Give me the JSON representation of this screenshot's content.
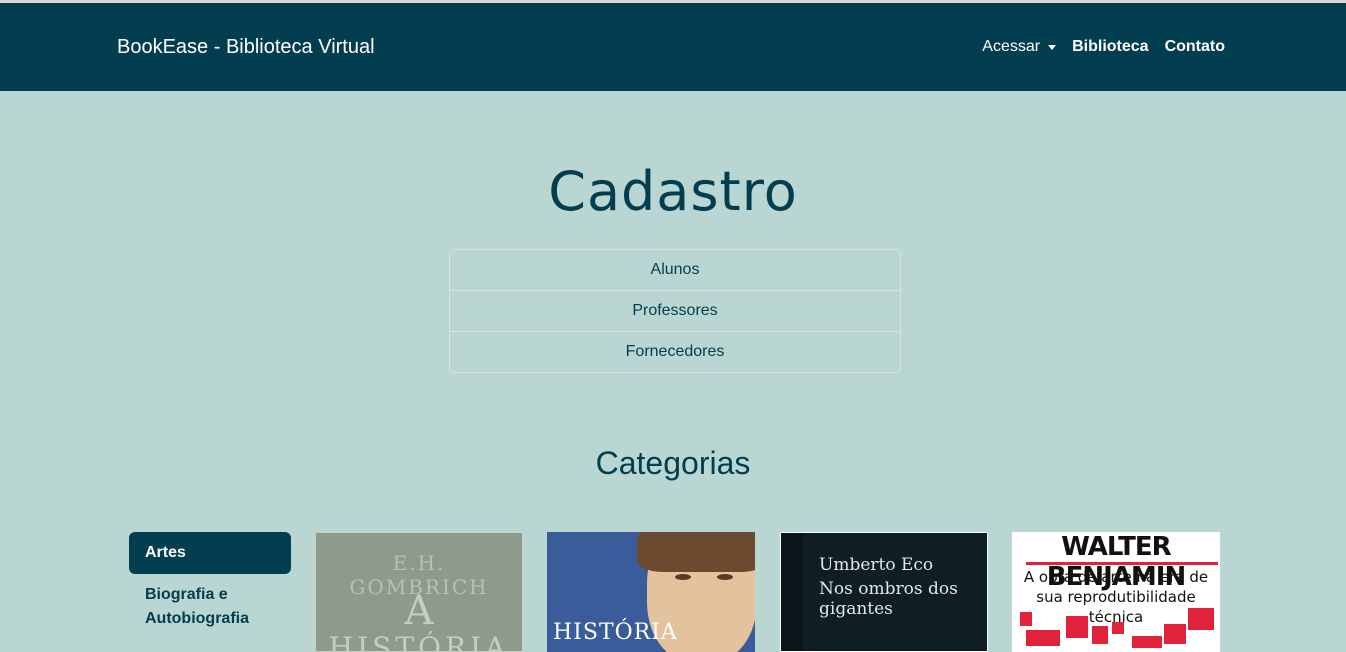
{
  "navbar": {
    "brand": "BookEase - Biblioteca Virtual",
    "links": {
      "access": "Acessar",
      "library": "Biblioteca",
      "contact": "Contato"
    }
  },
  "register": {
    "title": "Cadastro",
    "items": [
      "Alunos",
      "Professores",
      "Fornecedores"
    ]
  },
  "categories": {
    "title": "Categorias",
    "items": [
      "Artes",
      "Biografia e Autobiografia"
    ],
    "active": "Artes"
  },
  "books": [
    {
      "cover_lines": [
        "E.H. GOMBRICH",
        "A",
        "HISTÓRIA"
      ]
    },
    {
      "cover_lines": [
        "HISTÓRIA"
      ]
    },
    {
      "cover_lines": [
        "Umberto Eco",
        "Nos ombros dos gigantes"
      ]
    },
    {
      "cover_lines": [
        "WALTER BENJAMIN",
        "A obra de arte na era de sua reprodutibilidade técnica"
      ]
    }
  ],
  "colors": {
    "primary": "#023d50",
    "background": "#bad6d2",
    "accent": "#e0223b"
  }
}
